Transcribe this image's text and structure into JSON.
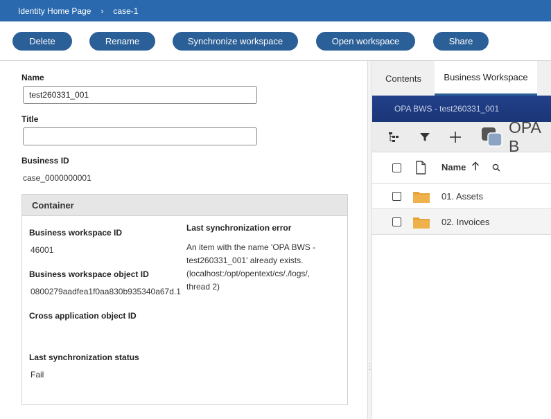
{
  "breadcrumb": {
    "items": [
      "Identity Home Page",
      "case-1"
    ],
    "separator": "›"
  },
  "toolbar": {
    "delete_label": "Delete",
    "rename_label": "Rename",
    "sync_label": "Synchronize workspace",
    "open_label": "Open workspace",
    "share_label": "Share"
  },
  "form": {
    "name_label": "Name",
    "name_value": "test260331_001",
    "title_label": "Title",
    "title_value": "",
    "business_id_label": "Business ID",
    "business_id_value": "case_0000000001"
  },
  "container": {
    "header": "Container",
    "bws_id_label": "Business workspace ID",
    "bws_id_value": "46001",
    "bws_obj_id_label": "Business workspace object ID",
    "bws_obj_id_value": "0800279aadfea1f0aa830b935340a67d.1",
    "cross_app_label": "Cross application object ID",
    "cross_app_value": "",
    "last_sync_status_label": "Last synchronization status",
    "last_sync_status_value": "Fail",
    "last_sync_error_label": "Last synchronization error",
    "last_sync_error_lines": [
      "An item with the name 'OPA BWS -",
      "test260331_001' already exists.",
      "(localhost:/opt/opentext/cs/./logs/,",
      "thread 2)"
    ]
  },
  "right_panel": {
    "tabs": [
      "Contents",
      "Business Workspace"
    ],
    "active_tab": "Business Workspace",
    "workspace_header": "OPA BWS - test260331_001",
    "workspace_title": "OPA B",
    "column_name_label": "Name",
    "rows": [
      "01. Assets",
      "02. Invoices"
    ]
  },
  "colors": {
    "topbar": "#2a69ad",
    "button": "#2b5f97",
    "workspace_header": "#1f3a7a",
    "folder": "#e8a33a"
  },
  "icons": [
    "chevron-right-icon",
    "tree-view-icon",
    "filter-icon",
    "add-icon",
    "workspace-icon",
    "checkbox-icon",
    "document-icon",
    "sort-ascending-icon",
    "search-icon",
    "folder-icon",
    "drag-handle-icon"
  ]
}
